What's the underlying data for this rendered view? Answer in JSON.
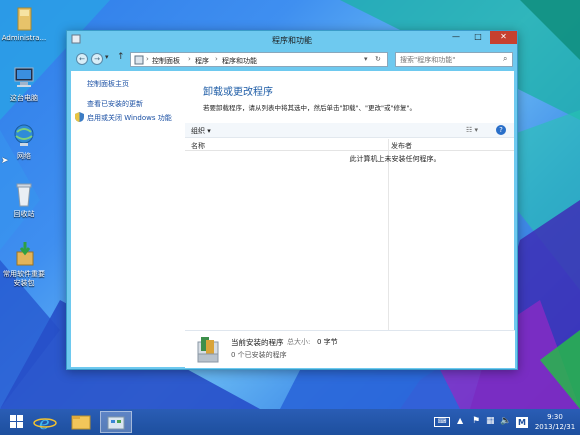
{
  "desktop": {
    "icons": [
      {
        "label": "Administra...",
        "icon": "user-folder-icon"
      },
      {
        "label": "这台电脑",
        "icon": "computer-icon"
      },
      {
        "label": "网络",
        "icon": "network-icon"
      },
      {
        "label": "回收站",
        "icon": "recycle-bin-icon"
      },
      {
        "label": "常用软件重要安装包",
        "icon": "installer-package-icon"
      }
    ]
  },
  "window": {
    "title": "程序和功能",
    "controls": {
      "minimize": "—",
      "maximize": "□",
      "close": "✕"
    },
    "nav": {
      "back": "←",
      "forward": "→",
      "up": "↑",
      "refresh": "↻"
    },
    "breadcrumb": [
      "控制面板",
      "程序",
      "程序和功能"
    ],
    "search_placeholder": "搜索\"程序和功能\"",
    "left_pane": {
      "home_link": "控制面板主页",
      "updates_link": "查看已安装的更新",
      "features_link": "启用或关闭 Windows 功能"
    },
    "heading": "卸载或更改程序",
    "description": "若要卸载程序，请从列表中将其选中，然后单击\"卸载\"、\"更改\"或\"修复\"。",
    "toolbar": {
      "organize": "组织 ▾"
    },
    "columns": {
      "name": "名称",
      "publisher": "发布者"
    },
    "empty_message": "此计算机上未安装任何程序。",
    "details": {
      "title": "当前安装的程序",
      "size_label": "总大小:",
      "size_value": "0 字节",
      "count": "0 个已安装的程序"
    }
  },
  "taskbar": {
    "items": [
      "start-icon",
      "internet-explorer-icon",
      "file-explorer-icon",
      "control-panel-icon"
    ],
    "tray": {
      "ime": "M"
    },
    "clock": {
      "time": "9:30",
      "date": "2013/12/31"
    }
  },
  "colors": {
    "accent": "#1e5ca6",
    "window_frame": "#6ec9ef",
    "taskbar": "#1d4f9e",
    "close": "#c7402f"
  }
}
